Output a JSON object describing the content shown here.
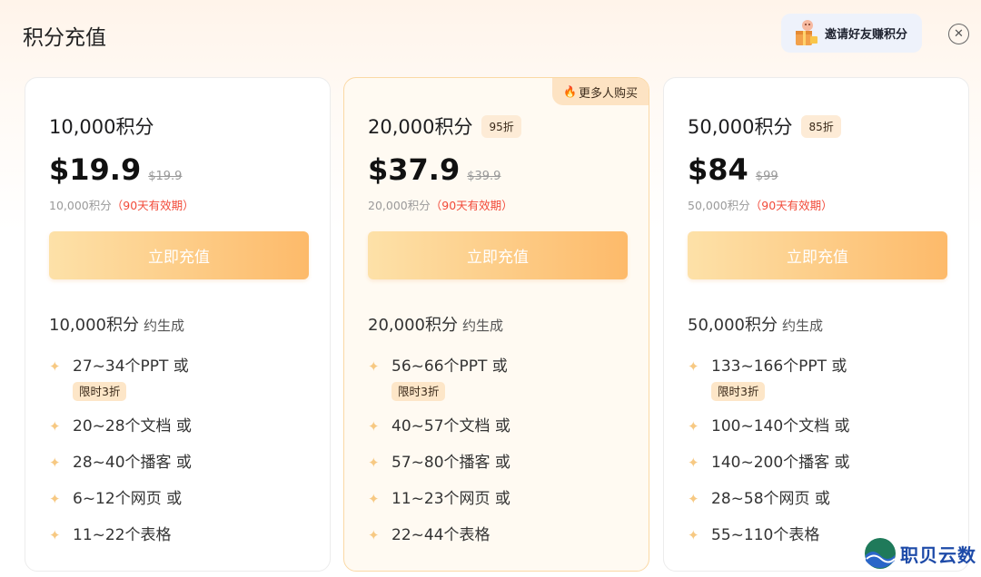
{
  "header": {
    "title": "积分充值",
    "invite_label": "邀请好友赚积分",
    "close_symbol": "✕"
  },
  "hot_tag": {
    "icon": "flame-icon",
    "label": "更多人购买"
  },
  "cards": [
    {
      "points": "10,000积分",
      "discount": "",
      "price": "$19.9",
      "original_price": "$19.9",
      "validity_points": "10,000积分",
      "validity_note": "（90天有效期）",
      "button": "立即充值",
      "gen_points": "10,000积分",
      "gen_about": "约生成",
      "features": [
        "27~34个PPT 或",
        "20~28个文档 或",
        "28~40个播客 或",
        "6~12个网页 或",
        "11~22个表格"
      ],
      "limit_badge": "限时3折"
    },
    {
      "points": "20,000积分",
      "discount": "95折",
      "price": "$37.9",
      "original_price": "$39.9",
      "validity_points": "20,000积分",
      "validity_note": "（90天有效期）",
      "button": "立即充值",
      "gen_points": "20,000积分",
      "gen_about": "约生成",
      "features": [
        "56~66个PPT 或",
        "40~57个文档 或",
        "57~80个播客 或",
        "11~23个网页 或",
        "22~44个表格"
      ],
      "limit_badge": "限时3折"
    },
    {
      "points": "50,000积分",
      "discount": "85折",
      "price": "$84",
      "original_price": "$99",
      "validity_points": "50,000积分",
      "validity_note": "（90天有效期）",
      "button": "立即充值",
      "gen_points": "50,000积分",
      "gen_about": "约生成",
      "features": [
        "133~166个PPT 或",
        "100~140个文档 或",
        "140~200个播客 或",
        "28~58个网页 或",
        "55~110个表格"
      ],
      "limit_badge": "限时3折"
    }
  ],
  "watermark": {
    "text": "职贝云数"
  },
  "colors": {
    "accent_gradient_start": "#fde1a8",
    "accent_gradient_end": "#fdba6a",
    "validity_red": "#f24b3a",
    "star": "#f7c983",
    "brand_blue": "#1d4aa8"
  }
}
